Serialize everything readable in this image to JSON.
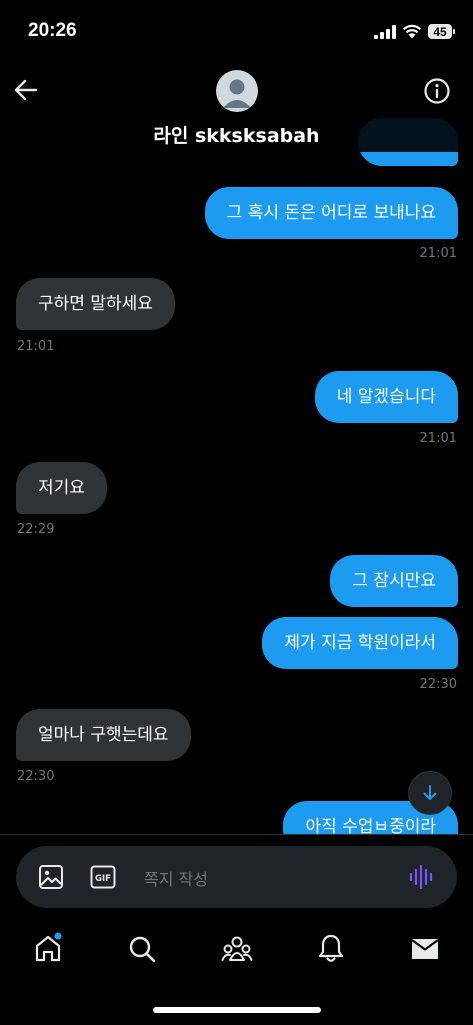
{
  "status_bar": {
    "time": "20:26",
    "battery_level": "45"
  },
  "header": {
    "contact_name": "라인 skksksabah",
    "back_icon": "arrow-left-icon",
    "info_icon": "info-icon"
  },
  "messages": [
    {
      "type": "sent",
      "text": "그 혹시 돈은 어디로 보내나요",
      "time": "21:01"
    },
    {
      "type": "received",
      "text": "구하면 말하세요",
      "time": "21:01"
    },
    {
      "type": "sent",
      "text": "네 알겠습니다",
      "time": "21:01"
    },
    {
      "type": "received",
      "text": "저기요",
      "time": "22:29"
    },
    {
      "type": "sent",
      "text": "그 잠시만요",
      "time": ""
    },
    {
      "type": "sent",
      "text": "제가 지금 학원이라서",
      "time": "22:30"
    },
    {
      "type": "received",
      "text": "얼마나 구햇는데요",
      "time": "22:30"
    },
    {
      "type": "sent",
      "text": "아직 수업ㅂ중이라",
      "time": ""
    }
  ],
  "composer": {
    "placeholder": "쪽지 작성",
    "gif_label": "GIF"
  },
  "tabs": [
    "home",
    "search",
    "communities",
    "notifications",
    "messages"
  ],
  "colors": {
    "accent": "#1d9bf0",
    "received_bubble": "#2f3336",
    "background": "#000000",
    "voice_icon": "#7856ff"
  }
}
